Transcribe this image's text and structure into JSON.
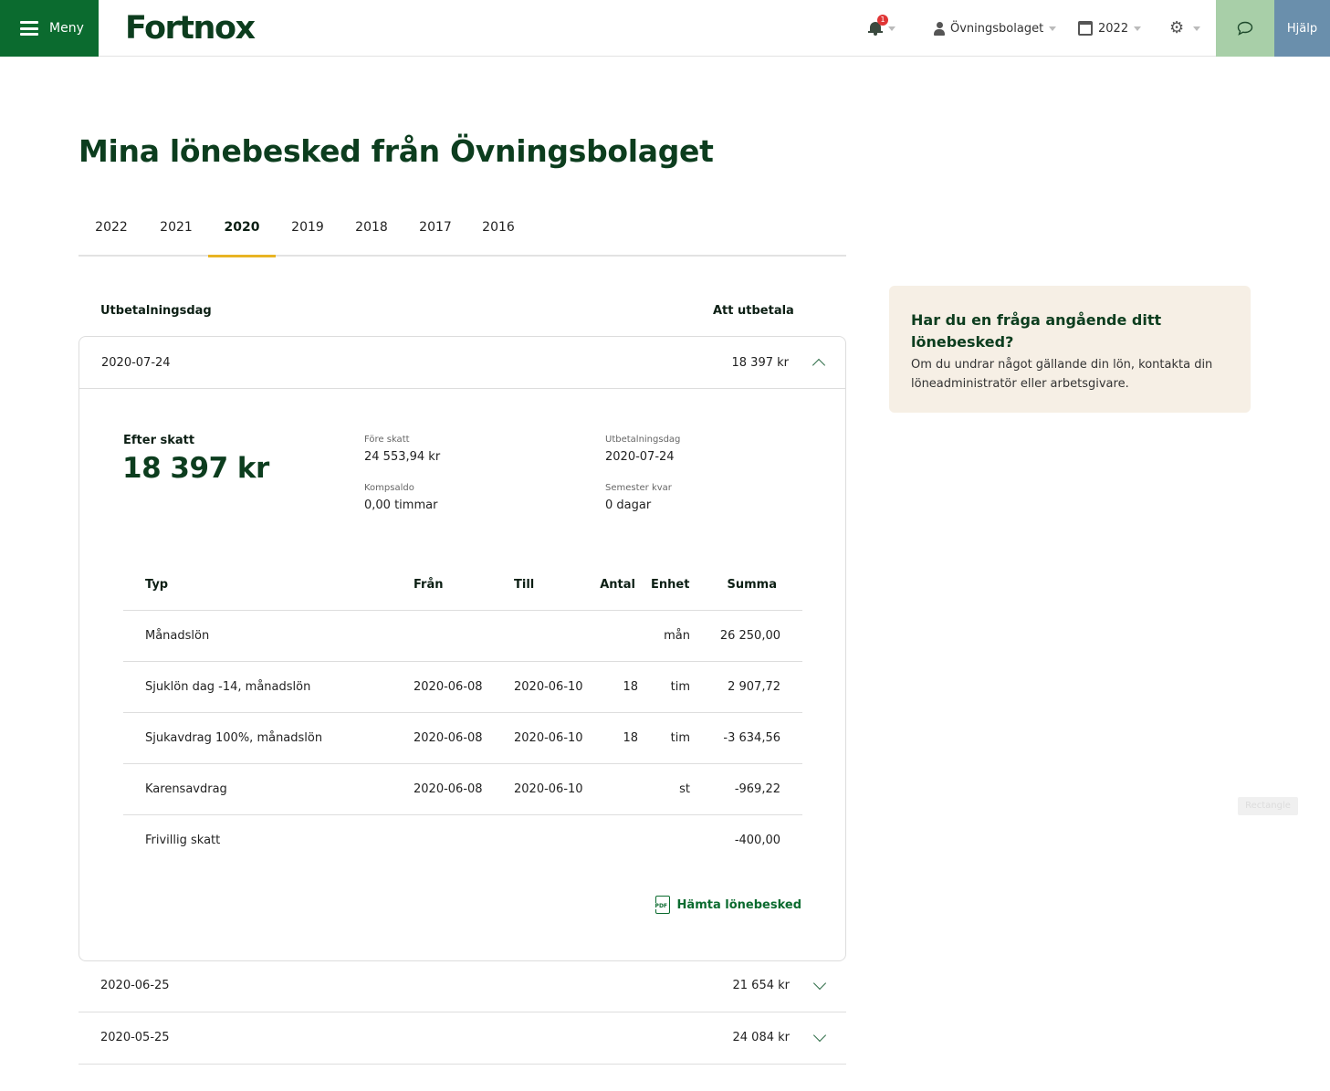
{
  "topbar": {
    "menu_label": "Meny",
    "logo": "Fortnox",
    "notifications_count": "1",
    "company": "Övningsbolaget",
    "year": "2022",
    "help_label": "Hjälp"
  },
  "page": {
    "title": "Mina lönebesked från Övningsbolaget"
  },
  "tabs": [
    "2022",
    "2021",
    "2020",
    "2019",
    "2018",
    "2017",
    "2016"
  ],
  "active_tab": "2020",
  "list": {
    "col_date": "Utbetalningsdag",
    "col_amount": "Att utbetala"
  },
  "expanded": {
    "date": "2020-07-24",
    "amount": "18 397 kr",
    "after_tax_label": "Efter skatt",
    "after_tax_value": "18 397 kr",
    "pre_tax_label": "Före skatt",
    "pre_tax_value": "24 553,94 kr",
    "comp_label": "Kompsaldo",
    "comp_value": "0,00 timmar",
    "paydate_label": "Utbetalningsdag",
    "paydate_value": "2020-07-24",
    "vacation_label": "Semester kvar",
    "vacation_value": "0 dagar",
    "table": {
      "headers": {
        "type": "Typ",
        "from": "Från",
        "to": "Till",
        "qty": "Antal",
        "unit": "Enhet",
        "sum": "Summa"
      },
      "rows": [
        {
          "type": "Månadslön",
          "from": "",
          "to": "",
          "qty": "",
          "unit": "mån",
          "sum": "26 250,00"
        },
        {
          "type": "Sjuklön dag -14, månadslön",
          "from": "2020-06-08",
          "to": "2020-06-10",
          "qty": "18",
          "unit": "tim",
          "sum": "2 907,72"
        },
        {
          "type": "Sjukavdrag 100%, månadslön",
          "from": "2020-06-08",
          "to": "2020-06-10",
          "qty": "18",
          "unit": "tim",
          "sum": "-3 634,56"
        },
        {
          "type": "Karensavdrag",
          "from": "2020-06-08",
          "to": "2020-06-10",
          "qty": "",
          "unit": "st",
          "sum": "-969,22"
        },
        {
          "type": "Frivillig skatt",
          "from": "",
          "to": "",
          "qty": "",
          "unit": "",
          "sum": "-400,00"
        }
      ]
    },
    "download_label": "Hämta lönebesked",
    "pdf_icon_text": "PDF"
  },
  "collapsed_rows": [
    {
      "date": "2020-06-25",
      "amount": "21 654 kr"
    },
    {
      "date": "2020-05-25",
      "amount": "24 084 kr"
    }
  ],
  "info": {
    "title": "Har du en fråga angående ditt lönebesked?",
    "text": "Om du undrar något gällande din lön, kontakta din löneadministratör eller arbetsgivare."
  },
  "ghost_label": "Rectangle",
  "colors": {
    "brand_green": "#0b6b2f",
    "dark_green": "#0c3d1e",
    "tab_accent": "#e8b423",
    "info_bg": "#f6efe5",
    "chat_bg": "#a8cfa8",
    "help_bg": "#6a8fac",
    "badge_red": "#e03535"
  }
}
